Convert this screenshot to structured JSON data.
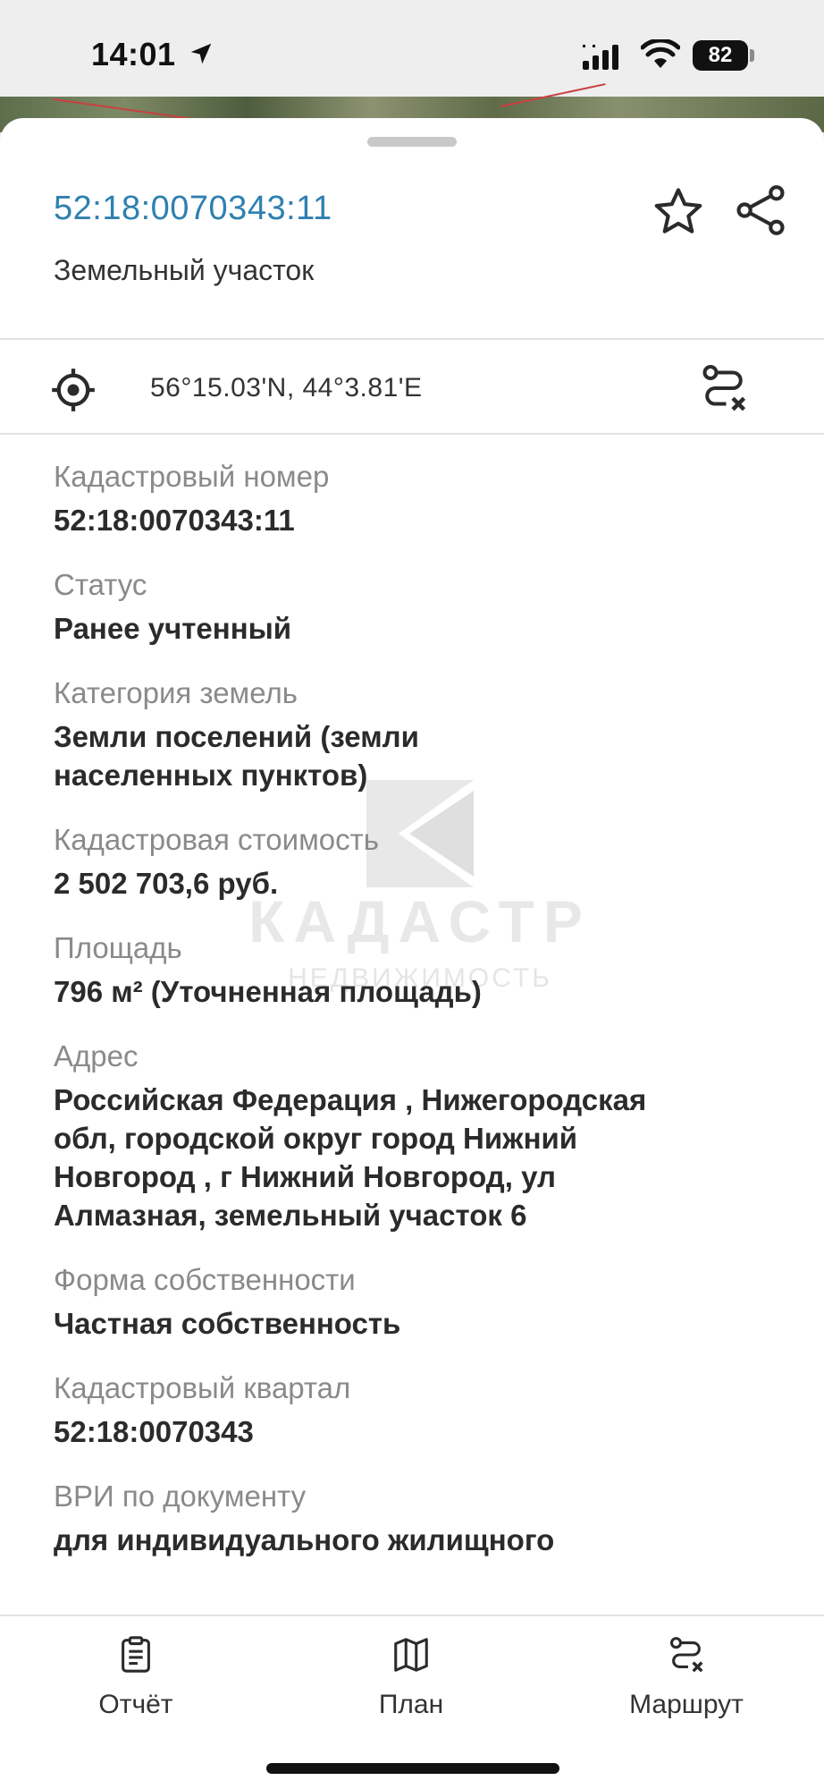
{
  "status_bar": {
    "time": "14:01",
    "battery": "82"
  },
  "parcel": {
    "number": "52:18:0070343:11",
    "type": "Земельный участок",
    "coordinates": "56°15.03'N, 44°3.81'E"
  },
  "properties": [
    {
      "label": "Кадастровый номер",
      "value": "52:18:0070343:11"
    },
    {
      "label": "Статус",
      "value": "Ранее учтенный"
    },
    {
      "label": "Категория земель",
      "value": "Земли поселений (земли\nнаселенных пунктов)"
    },
    {
      "label": "Кадастровая стоимость",
      "value": "2 502 703,6 руб."
    },
    {
      "label": "Площадь",
      "value": "796 м² (Уточненная площадь)"
    },
    {
      "label": "Адрес",
      "value": "Российская Федерация , Нижегородская\nобл, городской округ город Нижний\nНовгород , г Нижний Новгород, ул\nАлмазная, земельный участок 6"
    },
    {
      "label": "Форма собственности",
      "value": "Частная собственность"
    },
    {
      "label": "Кадастровый квартал",
      "value": "52:18:0070343"
    },
    {
      "label": "ВРИ по документу",
      "value": "для индивидуального жилищного"
    }
  ],
  "watermark": {
    "main": "КАДАСТР",
    "sub": "НЕДВИЖИМОСТЬ"
  },
  "bottom_nav": {
    "report_label": "Отчёт",
    "plan_label": "План",
    "route_label": "Маршрут"
  },
  "colors": {
    "accent_link": "#2f80b0",
    "label_gray": "#8a8a8a",
    "value_text": "#2b2b2b"
  }
}
